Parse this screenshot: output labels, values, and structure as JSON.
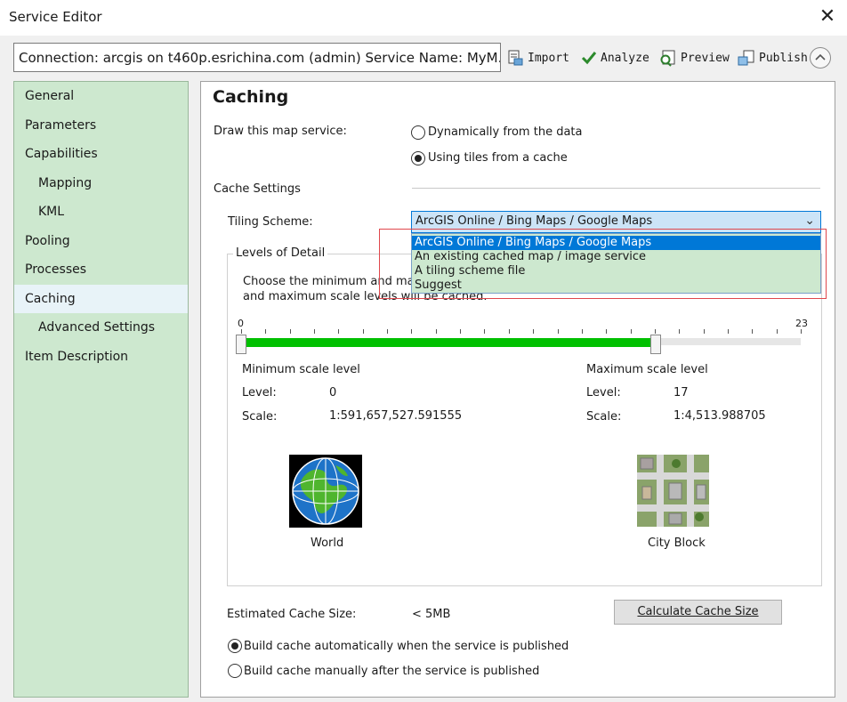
{
  "window": {
    "title": "Service Editor"
  },
  "connection": {
    "text": "Connection: arcgis on t460p.esrichina.com (admin)    Service Name: MyM..."
  },
  "toolbar": {
    "import": "Import",
    "analyze": "Analyze",
    "preview": "Preview",
    "publish": "Publish"
  },
  "sidebar": {
    "items": [
      {
        "label": "General"
      },
      {
        "label": "Parameters"
      },
      {
        "label": "Capabilities"
      },
      {
        "label": "Mapping"
      },
      {
        "label": "KML"
      },
      {
        "label": "Pooling"
      },
      {
        "label": "Processes"
      },
      {
        "label": "Caching"
      },
      {
        "label": "Advanced Settings"
      },
      {
        "label": "Item Description"
      }
    ],
    "active": "Caching"
  },
  "caching": {
    "title": "Caching",
    "draw_label": "Draw this map service:",
    "option_dynamic": "Dynamically from the data",
    "option_tiles": "Using tiles from a cache",
    "cache_settings": "Cache Settings",
    "tiling_label": "Tiling Scheme:",
    "tiling_value": "ArcGIS Online / Bing Maps / Google Maps",
    "tiling_options": [
      "ArcGIS Online / Bing Maps / Google Maps",
      "An existing cached map / image service",
      "A tiling scheme file",
      "Suggest"
    ],
    "levels_title": "Levels of Detail",
    "choose_line1": "Choose the minimum and maxim",
    "choose_line2": "and maximum scale levels will be cached.",
    "slider": {
      "min_label": "0",
      "max_label": "23",
      "min_value": 0,
      "max_value": 17,
      "range_max": 23
    },
    "min_scale": {
      "heading": "Minimum scale level",
      "level_label": "Level:",
      "level": "0",
      "scale_label": "Scale:",
      "scale": "1:591,657,527.591555",
      "caption": "World"
    },
    "max_scale": {
      "heading": "Maximum scale level",
      "level_label": "Level:",
      "level": "17",
      "scale_label": "Scale:",
      "scale": "1:4,513.988705",
      "caption": "City Block"
    },
    "estimated_label": "Estimated Cache Size:",
    "estimated_value": "< 5MB",
    "calc_button": "Calculate Cache Size",
    "build_auto": "Build cache automatically when the service is published",
    "build_manual": "Build cache manually after the service is published"
  },
  "colors": {
    "sidebar_bg": "#cde8cf",
    "selection": "#0078d7",
    "slider_fill": "#00c000",
    "highlight_box": "#e0474c"
  }
}
